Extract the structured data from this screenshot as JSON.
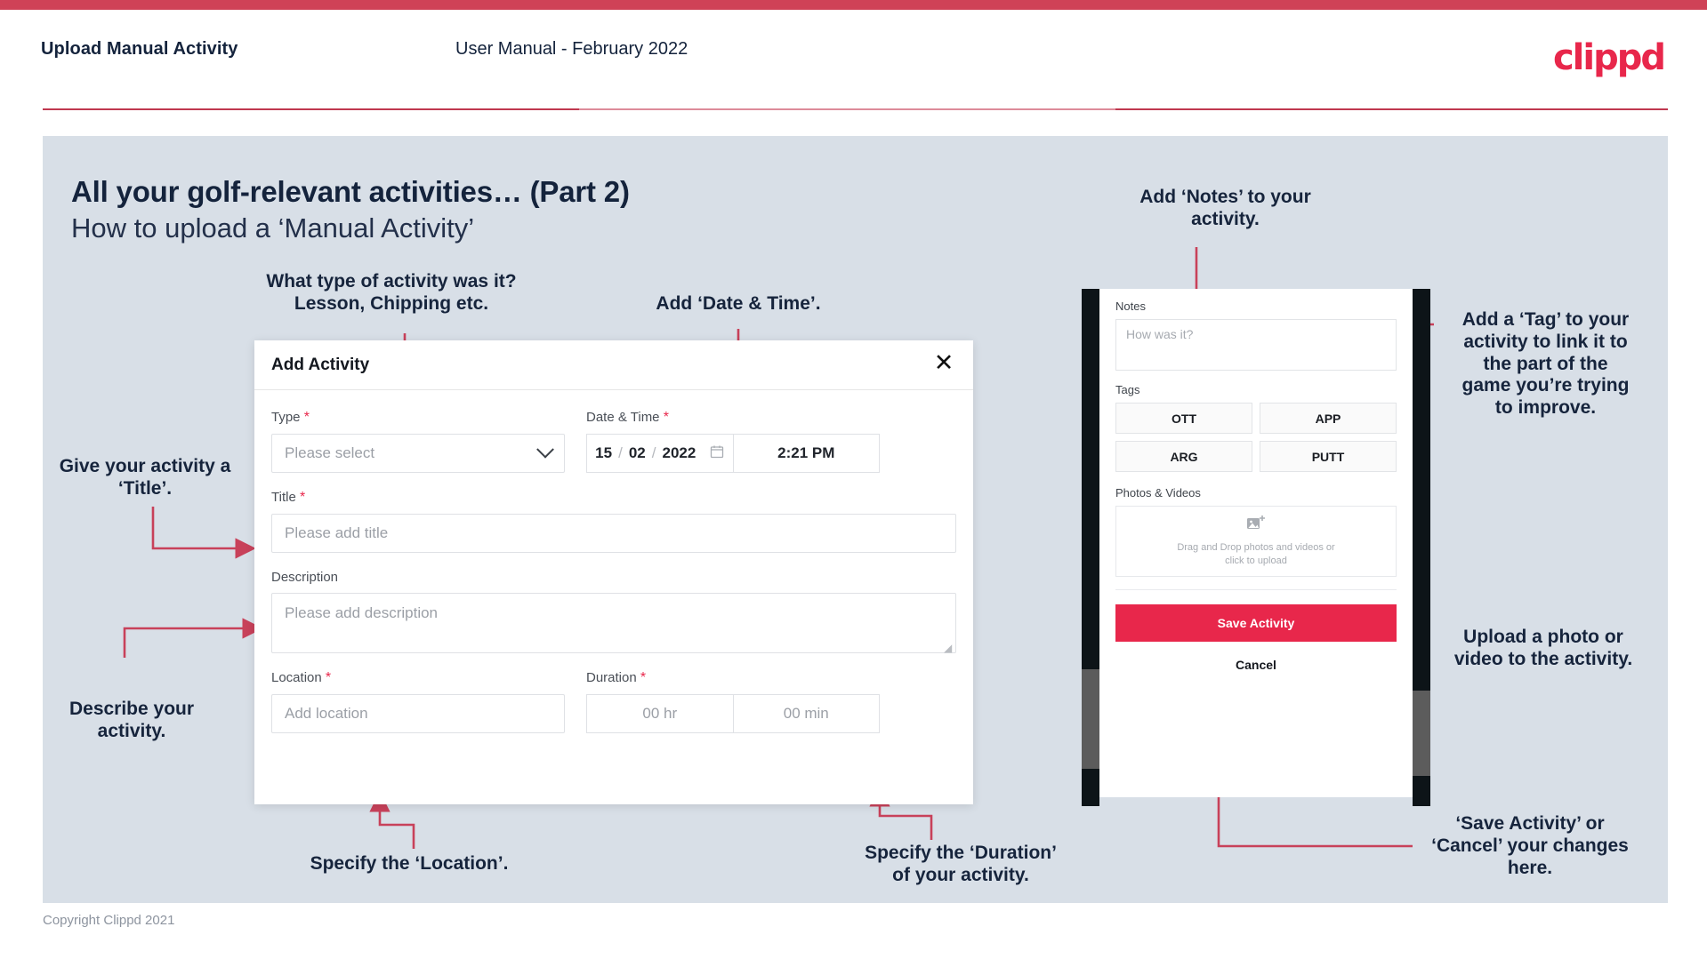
{
  "header": {
    "title": "Upload Manual Activity",
    "subtitle": "User Manual - February 2022",
    "brand": "clippd"
  },
  "slide": {
    "title": "All your golf-relevant activities… (Part 2)",
    "subtitle": "How to upload a ‘Manual Activity’"
  },
  "footer": {
    "copyright": "Copyright Clippd 2021"
  },
  "annotations": {
    "type": "What type of activity was it?\nLesson, Chipping etc.",
    "datetime": "Add ‘Date & Time’.",
    "title_note": "Give your activity a\n‘Title’.",
    "description": "Describe your\nactivity.",
    "location": "Specify the ‘Location’.",
    "duration": "Specify the ‘Duration’\nof your activity.",
    "notes": "Add ‘Notes’ to your\nactivity.",
    "tags": "Add a ‘Tag’ to your\nactivity to link it to\nthe part of the\ngame you’re trying\nto improve.",
    "upload": "Upload a photo or\nvideo to the activity.",
    "save_cancel": "‘Save Activity’ or\n‘Cancel’ your changes\nhere."
  },
  "modal": {
    "title": "Add Activity",
    "close_icon": "close-icon",
    "fields": {
      "type": {
        "label": "Type",
        "required": "*",
        "placeholder": "Please select"
      },
      "datetime": {
        "label": "Date & Time",
        "required": "*",
        "day": "15",
        "month": "02",
        "year": "2022",
        "sep": "/",
        "time": "2:21 PM"
      },
      "title": {
        "label": "Title",
        "required": "*",
        "placeholder": "Please add title"
      },
      "description": {
        "label": "Description",
        "placeholder": "Please add description"
      },
      "location": {
        "label": "Location",
        "required": "*",
        "placeholder": "Add location"
      },
      "duration": {
        "label": "Duration",
        "required": "*",
        "hours_placeholder": "00 hr",
        "minutes_placeholder": "00 min"
      }
    }
  },
  "phone": {
    "notes": {
      "label": "Notes",
      "placeholder": "How was it?"
    },
    "tags": {
      "label": "Tags",
      "items": [
        "OTT",
        "APP",
        "ARG",
        "PUTT"
      ]
    },
    "photos": {
      "label": "Photos & Videos",
      "dropzone_line1": "Drag and Drop photos and videos or",
      "dropzone_line2": "click to upload"
    },
    "save_label": "Save Activity",
    "cancel_label": "Cancel"
  },
  "colors": {
    "brand_pink": "#e8274b",
    "strip": "#cf4257",
    "slide_bg": "#d8dfe7",
    "arrow": "#c8415a",
    "text_dark": "#14233c"
  }
}
